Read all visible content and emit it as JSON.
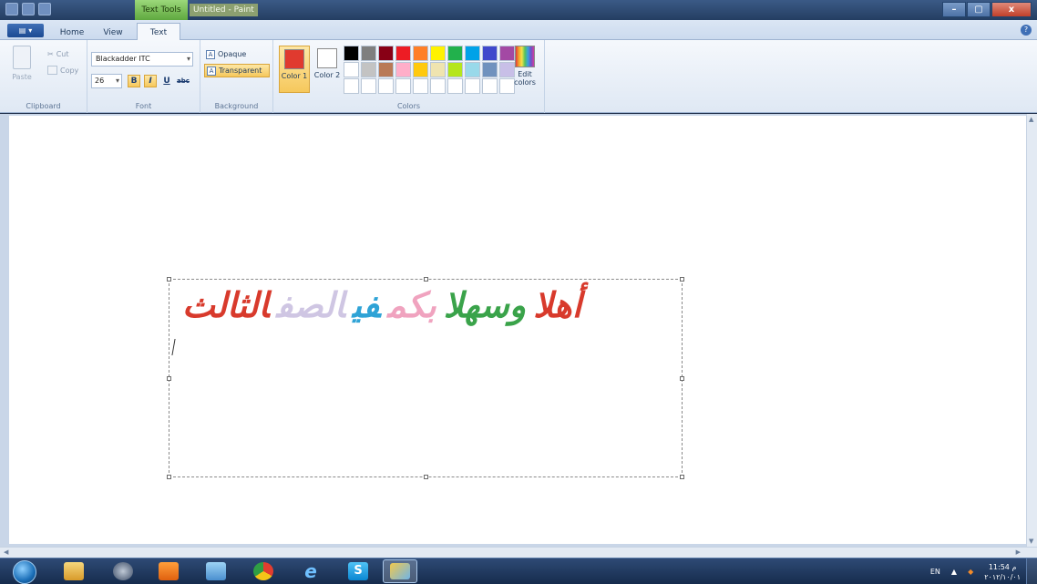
{
  "window": {
    "context_tab": "Text Tools",
    "title": "Untitled - Paint",
    "controls": {
      "minimize": "–",
      "maximize": "▢",
      "close": "x"
    }
  },
  "ribbon_tabs": [
    {
      "label": "Home",
      "active": false
    },
    {
      "label": "View",
      "active": false
    },
    {
      "label": "Text",
      "active": true
    }
  ],
  "clipboard": {
    "paste": "Paste",
    "cut": "Cut",
    "copy": "Copy",
    "group_label": "Clipboard"
  },
  "font": {
    "family": "Blackadder ITC",
    "size": "26",
    "bold": "B",
    "italic": "I",
    "underline": "U",
    "strikethrough": "abc",
    "group_label": "Font"
  },
  "background": {
    "opaque": "Opaque",
    "transparent": "Transparent",
    "selected": "Transparent",
    "group_label": "Background"
  },
  "colors": {
    "color1_label": "Color 1",
    "color1_value": "#e03a2f",
    "color2_label": "Color 2",
    "color2_value": "#ffffff",
    "edit_label": "Edit colors",
    "group_label": "Colors",
    "palette": [
      "#000000",
      "#7f7f7f",
      "#880015",
      "#ed1c24",
      "#ff7f27",
      "#fff200",
      "#22b14c",
      "#00a2e8",
      "#3f48cc",
      "#a349a4",
      "#ffffff",
      "#c3c3c3",
      "#b97a57",
      "#ffaec9",
      "#ffc90e",
      "#efe4b0",
      "#b5e61d",
      "#99d9ea",
      "#7092be",
      "#c8bfe7",
      "#ffffff",
      "#ffffff",
      "#ffffff",
      "#ffffff",
      "#ffffff",
      "#ffffff",
      "#ffffff",
      "#ffffff",
      "#ffffff",
      "#ffffff"
    ]
  },
  "canvas_text": {
    "words": [
      {
        "text": "أهلا",
        "color": "#d83a2c"
      },
      {
        "text": "وسهلا",
        "color": "#3aa34a"
      },
      {
        "text": "بكم",
        "color": "#f0a3bf"
      },
      {
        "text": "في",
        "color": "#2fa3d6"
      },
      {
        "text": "الصف",
        "color": "#cfc6e3"
      },
      {
        "text": "الثالث",
        "color": "#d83a2c"
      }
    ]
  },
  "taskbar": {
    "apps": [
      "windows-explorer-icon",
      "media-center-icon",
      "media-player-icon",
      "photo-viewer-icon",
      "chrome-icon",
      "internet-explorer-icon",
      "skype-icon",
      "paint-icon"
    ],
    "language": "EN",
    "time": "11:54 م",
    "date": "٢٠١٢/١٠/٠١"
  }
}
